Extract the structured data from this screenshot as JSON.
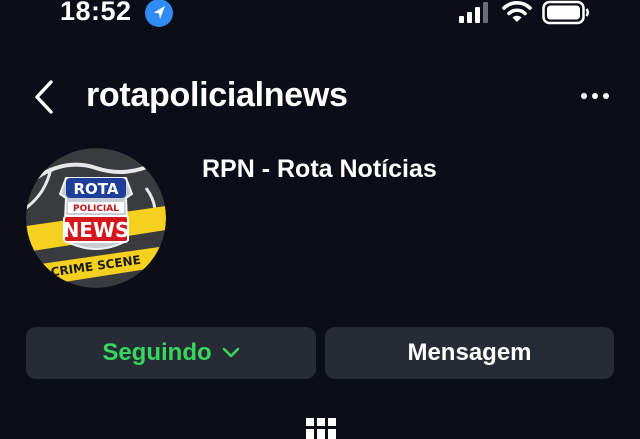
{
  "status_bar": {
    "time": "18:52",
    "icons": [
      "location-arrow-icon",
      "cellular-signal-icon",
      "wifi-icon",
      "battery-icon"
    ]
  },
  "header": {
    "username": "rotapolicialnews",
    "icons": [
      "back-chevron-icon",
      "more-options-icon"
    ]
  },
  "profile": {
    "display_name": "RPN - Rota Notícias",
    "avatar_logo": {
      "line1": "ROTA",
      "line2": "POLICIAL",
      "line3": "NEWS",
      "background_tape": "CRIME SCENE"
    }
  },
  "actions": {
    "follow_label": "Seguindo",
    "message_label": "Mensagem"
  },
  "tabs": {
    "icons": [
      "grid-icon"
    ]
  },
  "colors": {
    "background": "#0b0e17",
    "button_bg": "#272b36",
    "following_green": "#38d65c",
    "location_blue": "#2f8cf6"
  }
}
